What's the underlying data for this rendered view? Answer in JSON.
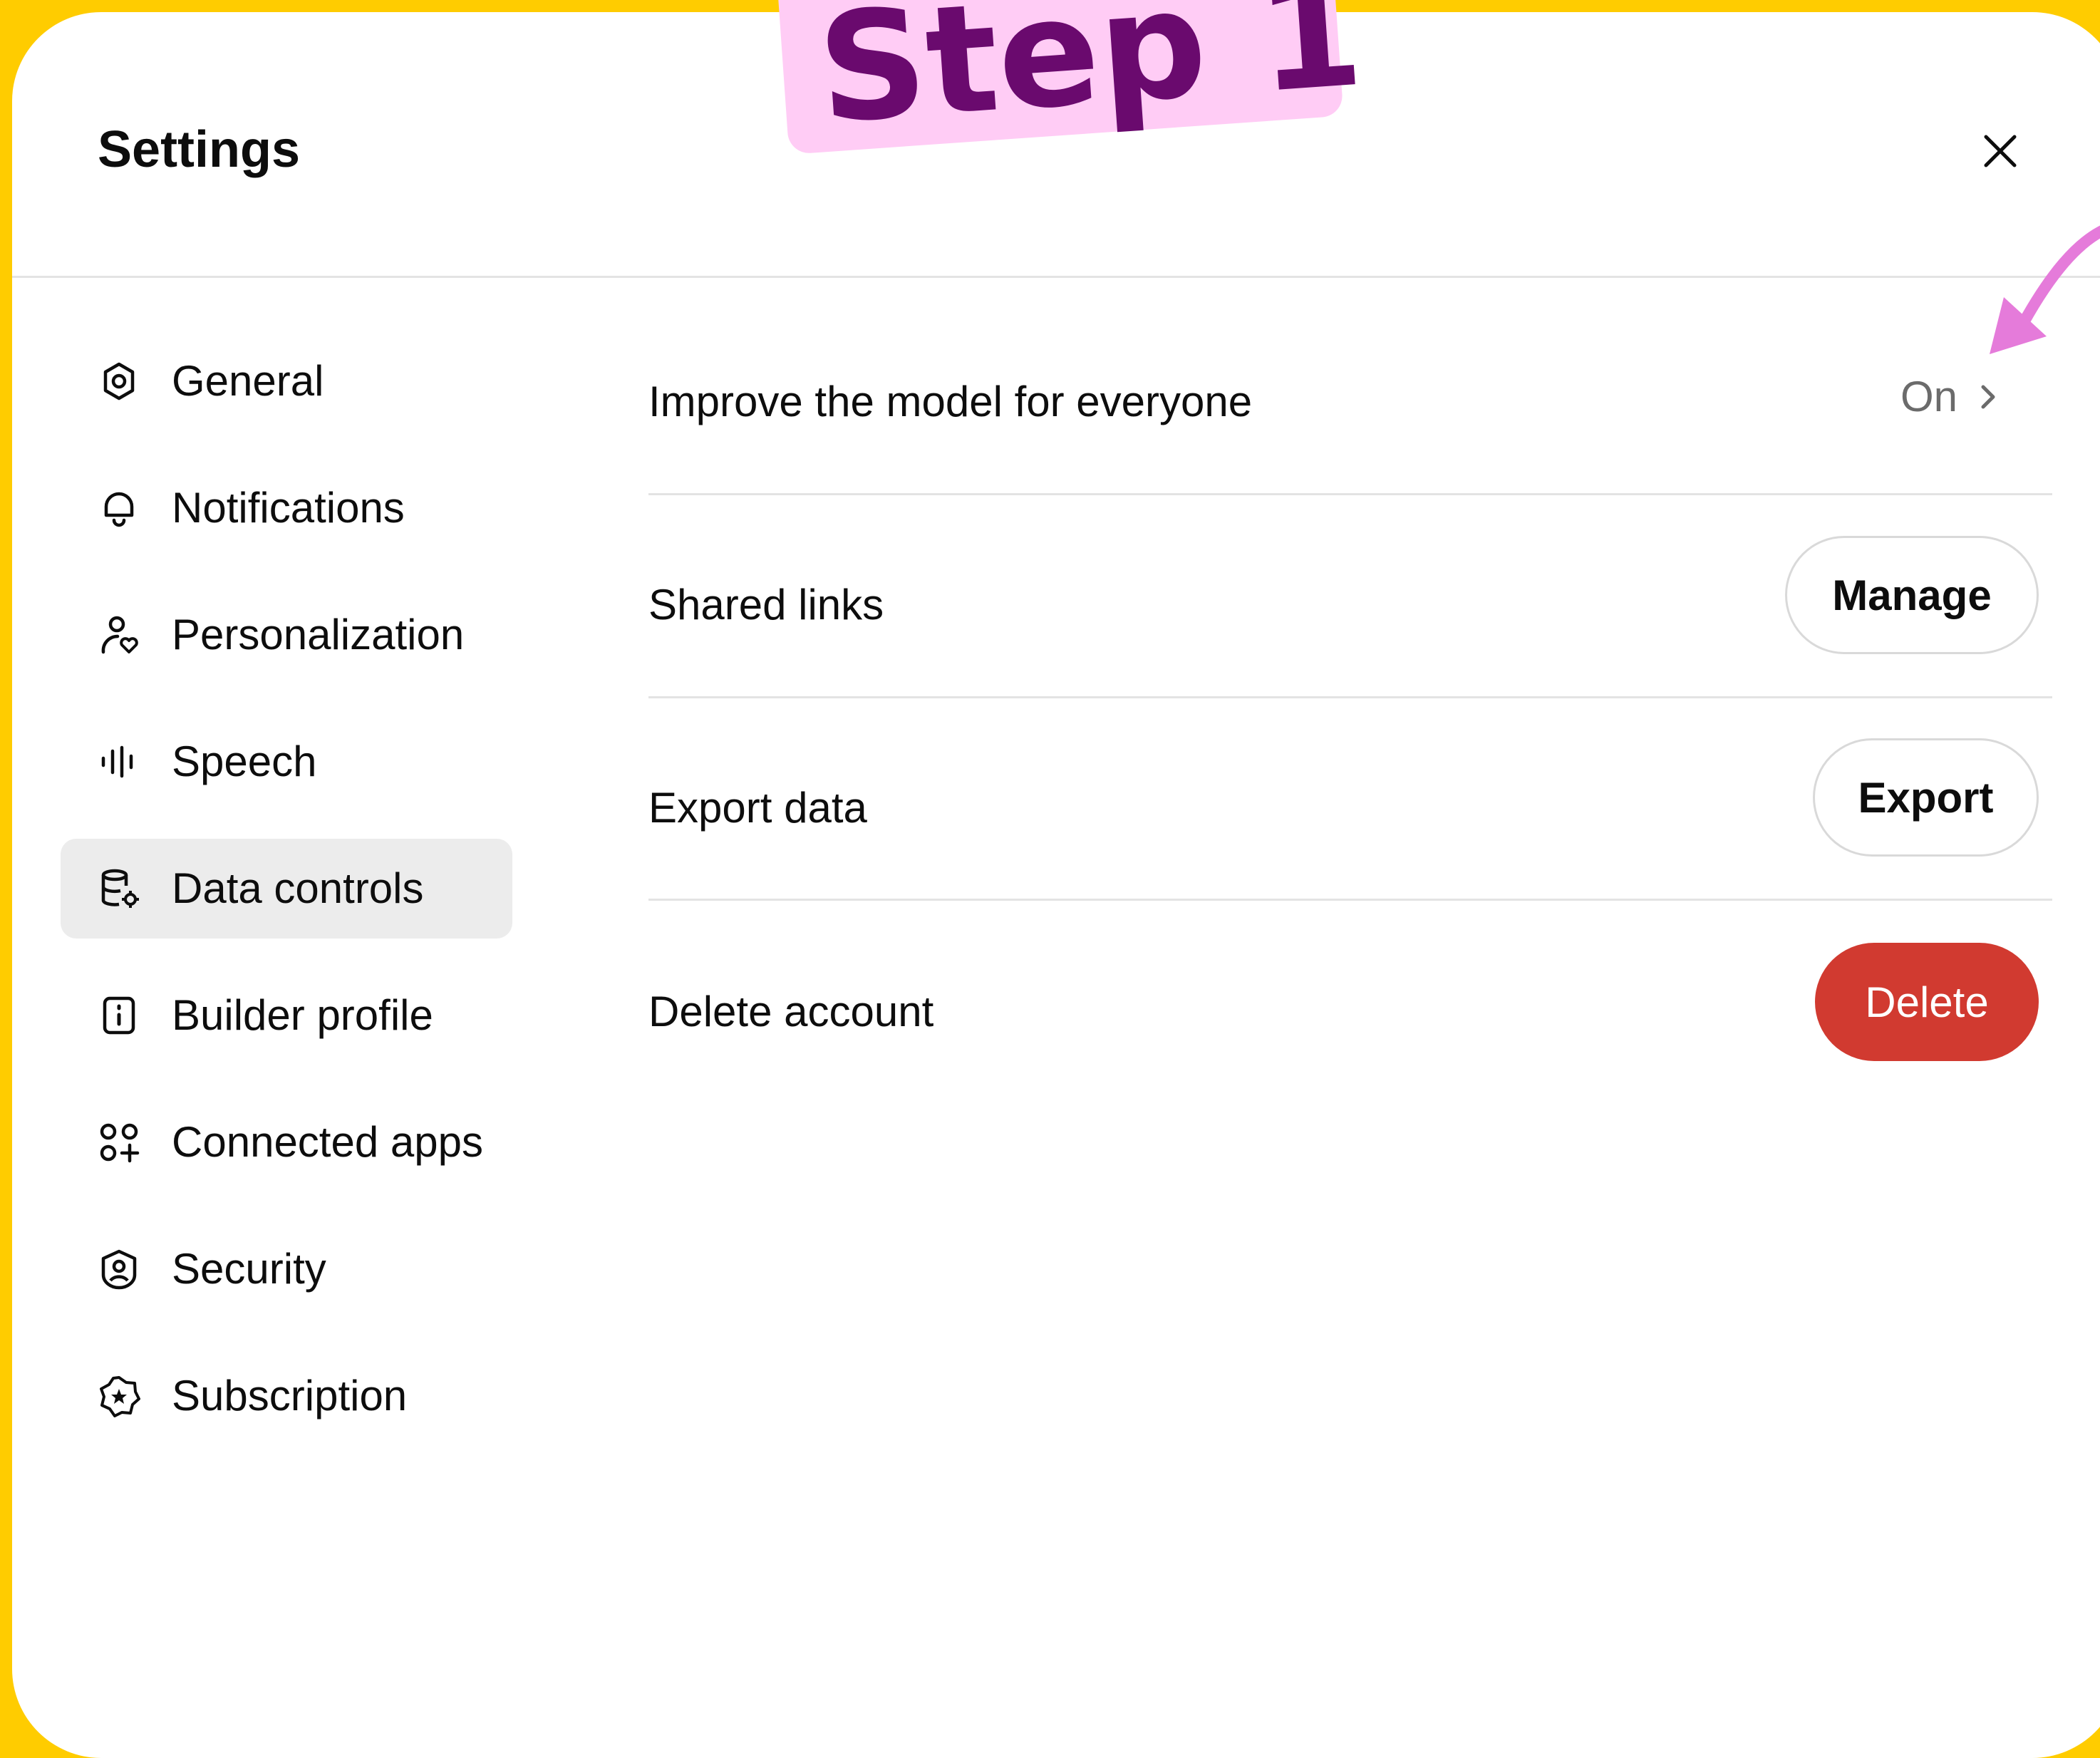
{
  "colors": {
    "background": "#FFCC00",
    "panel": "#FFFFFF",
    "sticker_bg": "#FFCCF5",
    "sticker_text": "#6A0A6E",
    "arrow": "#E57BDA",
    "danger": "#D13A30",
    "active_nav": "#ECECEC"
  },
  "annotation": {
    "label": "Step 1"
  },
  "dialog": {
    "title": "Settings",
    "close_icon": "close-icon"
  },
  "sidebar": {
    "active_index": 4,
    "items": [
      {
        "label": "General",
        "icon": "gear-icon"
      },
      {
        "label": "Notifications",
        "icon": "bell-icon"
      },
      {
        "label": "Personalization",
        "icon": "person-heart-icon"
      },
      {
        "label": "Speech",
        "icon": "waveform-icon"
      },
      {
        "label": "Data controls",
        "icon": "database-gear-icon"
      },
      {
        "label": "Builder profile",
        "icon": "id-badge-icon"
      },
      {
        "label": "Connected apps",
        "icon": "apps-grid-icon"
      },
      {
        "label": "Security",
        "icon": "shield-user-icon"
      },
      {
        "label": "Subscription",
        "icon": "star-badge-icon"
      }
    ]
  },
  "content": {
    "rows": [
      {
        "label": "Improve the model for everyone",
        "control": "status",
        "value": "On",
        "icon": "chevron-right-icon"
      },
      {
        "label": "Shared links",
        "control": "button",
        "button_label": "Manage"
      },
      {
        "label": "Export data",
        "control": "button",
        "button_label": "Export"
      },
      {
        "label": "Delete account",
        "control": "danger-button",
        "button_label": "Delete"
      }
    ]
  }
}
